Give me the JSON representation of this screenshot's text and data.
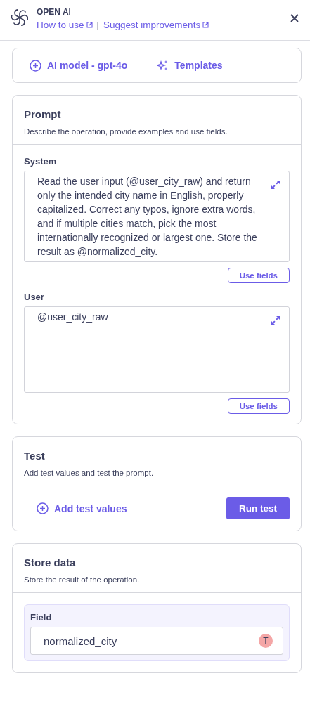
{
  "header": {
    "title": "OPEN AI",
    "links": [
      "How to use",
      "Suggest improvements"
    ],
    "separator": "|"
  },
  "toolbar": {
    "buttons": [
      {
        "kind": "add",
        "label": "AI model - gpt-4o"
      },
      {
        "kind": "sparkle",
        "label": "Templates"
      }
    ]
  },
  "prompt": {
    "title": "Prompt",
    "description": "Describe the operation, provide examples and use fields.",
    "fields": [
      {
        "label": "System",
        "value": "Read the user input (@user_city_raw) and return only the intended city name in English, properly capitalized. Correct any typos, ignore extra words, and if multiple cities match, pick the most internationally recognized or largest one. Store the result as @normalized_city.",
        "action": "Use fields"
      },
      {
        "label": "User",
        "value": "@user_city_raw",
        "action": "Use fields"
      }
    ]
  },
  "test": {
    "title": "Test",
    "description": "Add test values and test the prompt.",
    "add_label": "Add test values",
    "run_label": "Run test"
  },
  "store": {
    "title": "Store data",
    "description": "Store the result of the operation.",
    "field_label": "Field",
    "field_value": "normalized_city",
    "type_badge": "T"
  }
}
